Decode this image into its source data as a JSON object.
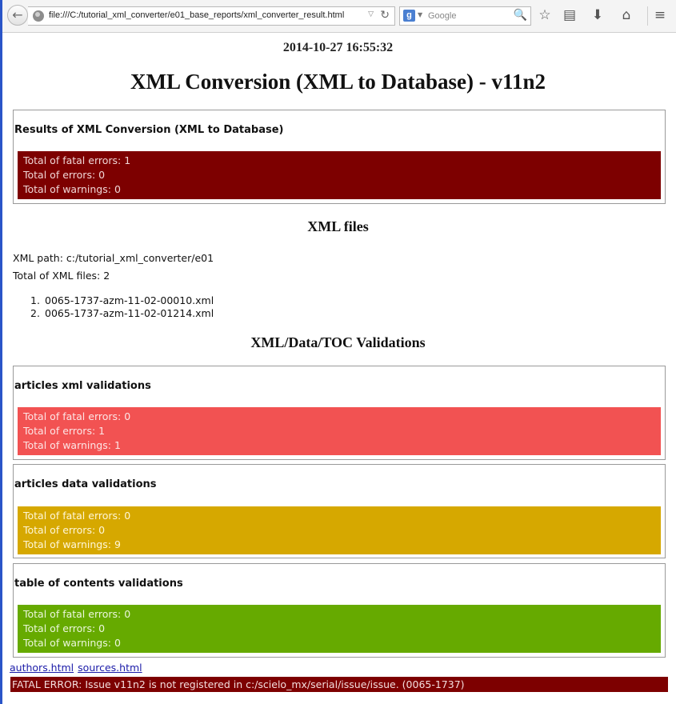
{
  "browser": {
    "url": "file:///C:/tutorial_xml_converter/e01_base_reports/xml_converter_result.html",
    "search_placeholder": "Google",
    "search_engine_badge": "g",
    "back_glyph": "←",
    "reload_glyph": "↻",
    "dropdown_glyph": "▽",
    "magnify_glyph": "🔍",
    "toolbar_icons": [
      "star-icon",
      "reading-list-icon",
      "download-icon",
      "home-icon",
      "menu-icon"
    ]
  },
  "report": {
    "timestamp": "2014-10-27 16:55:32",
    "title": "XML Conversion (XML to Database) - v11n2",
    "summary": {
      "heading": "Results of XML Conversion (XML to Database)",
      "lines": [
        "Total of fatal errors: 1",
        "Total of errors: 0",
        "Total of warnings: 0"
      ],
      "color": "#7d0000"
    },
    "xml_files": {
      "heading": "XML files",
      "path_line": "XML path: c:/tutorial_xml_converter/e01",
      "total_line": "Total of XML files: 2",
      "files": [
        "0065-1737-azm-11-02-00010.xml",
        "0065-1737-azm-11-02-01214.xml"
      ]
    },
    "validations": {
      "heading": "XML/Data/TOC Validations",
      "articles_xml": {
        "title": "articles xml validations",
        "lines": [
          "Total of fatal errors: 0",
          "Total of errors: 1",
          "Total of warnings: 1"
        ],
        "color": "#f25252"
      },
      "articles_data": {
        "title": "articles data validations",
        "lines": [
          "Total of fatal errors: 0",
          "Total of errors: 0",
          "Total of warnings: 9"
        ],
        "color": "#d6a800"
      },
      "toc": {
        "title": "table of contents validations",
        "lines": [
          "Total of fatal errors: 0",
          "Total of errors: 0",
          "Total of warnings: 0"
        ],
        "color": "#66aa00"
      }
    },
    "links": [
      "authors.html",
      "sources.html"
    ],
    "fatal_error": "FATAL ERROR: Issue v11n2 is not registered in c:/scielo_mx/serial/issue/issue. (0065-1737)"
  }
}
